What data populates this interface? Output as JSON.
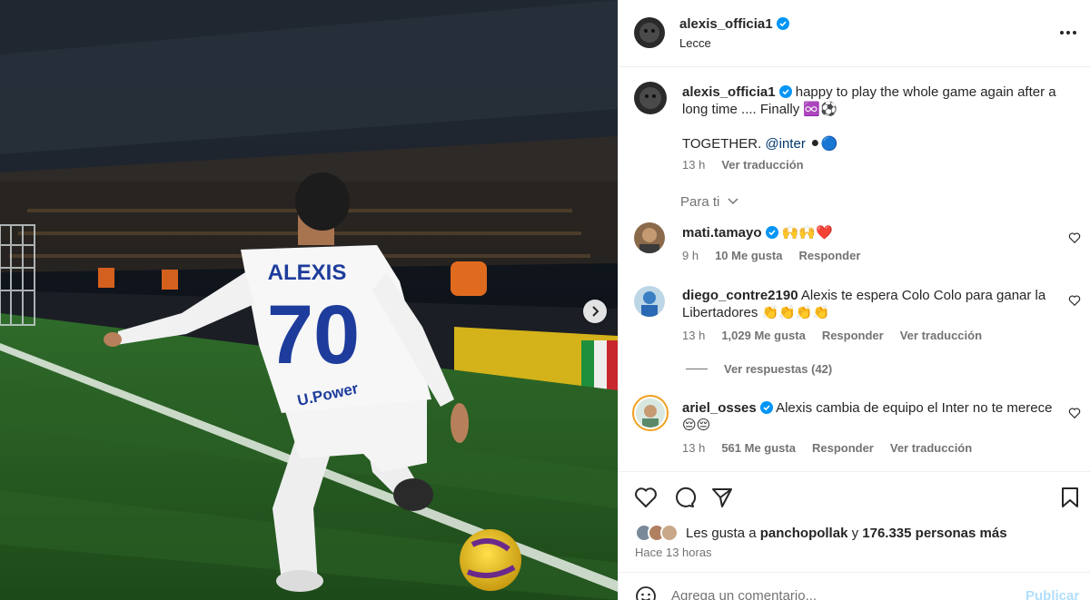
{
  "post": {
    "author": "alexis_officia1",
    "location": "Lecce",
    "caption_line1": "happy to play the whole game again after a long time .... Finally ♾️⚽️",
    "caption_line2_text": "TOGETHER.",
    "caption_mention": "@inter",
    "caption_emoji": "⚫🔵",
    "time": "13 h",
    "translate": "Ver traducción",
    "jersey_name": "ALEXIS",
    "jersey_number": "70",
    "sponsor": "U.Power"
  },
  "filter": {
    "label": "Para ti"
  },
  "comments": [
    {
      "user": "mati.tamayo",
      "text": "🙌🙌❤️",
      "time": "9 h",
      "likes": "10 Me gusta",
      "reply": "Responder",
      "translate": ""
    },
    {
      "user": "diego_contre2190",
      "text": "Alexis te espera Colo Colo para ganar la Libertadores 👏👏👏👏",
      "time": "13 h",
      "likes": "1,029 Me gusta",
      "reply": "Responder",
      "translate": "Ver traducción"
    },
    {
      "user": "ariel_osses",
      "text": "Alexis cambia de equipo el Inter no te merece 😔😔",
      "time": "13 h",
      "likes": "561 Me gusta",
      "reply": "Responder",
      "translate": "Ver traducción"
    }
  ],
  "view_replies": "Ver respuestas (42)",
  "likes_summary": {
    "prefix": "Les gusta a",
    "user": "panchopollak",
    "joiner": "y",
    "others": "176.335 personas más"
  },
  "posted_ago": "Hace 13 horas",
  "comment_box": {
    "placeholder": "Agrega un comentario...",
    "publish": "Publicar"
  },
  "colors": {
    "verified": "#0095f6",
    "link": "#00376b",
    "muted": "#737373",
    "publish_disabled": "#b2dffc"
  },
  "icons": [
    "more-options-icon",
    "verified-icon",
    "chevron-down-icon",
    "heart-icon",
    "comment-icon",
    "share-icon",
    "bookmark-icon",
    "emoji-icon",
    "next-arrow-icon"
  ]
}
